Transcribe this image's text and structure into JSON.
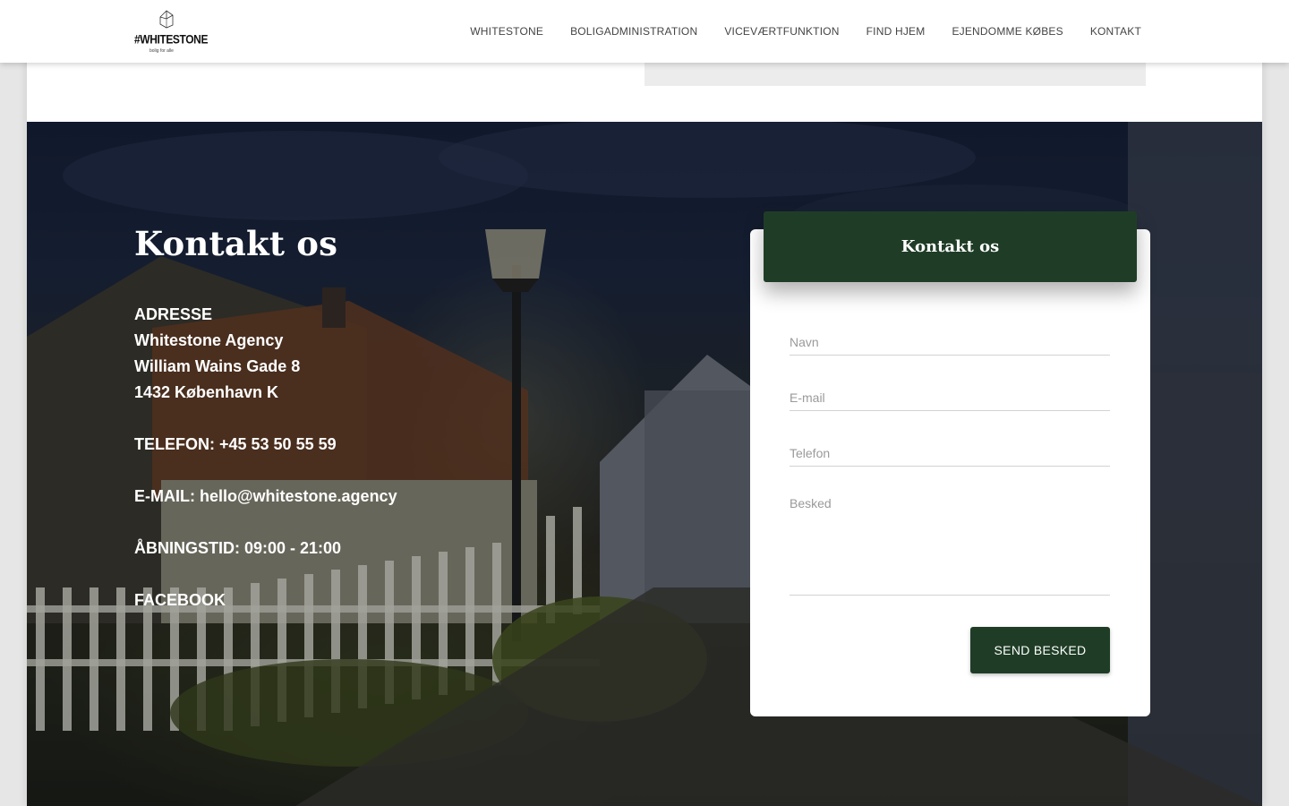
{
  "header": {
    "logo": {
      "name": "#WHITESTONE",
      "tagline": "bolig for alle"
    },
    "nav": [
      {
        "label": "WHITESTONE"
      },
      {
        "label": "BOLIGADMINISTRATION"
      },
      {
        "label": "VICEVÆRTFUNKTION"
      },
      {
        "label": "FIND HJEM"
      },
      {
        "label": "EJENDOMME KØBES"
      },
      {
        "label": "KONTAKT"
      }
    ]
  },
  "contact": {
    "title": "Kontakt os",
    "address_label": "ADRESSE",
    "address_lines": [
      "Whitestone Agency",
      "William Wains Gade 8",
      "1432 København K"
    ],
    "phone": "TELEFON: +45 53 50 55 59",
    "email": "E-MAIL: hello@whitestone.agency",
    "hours": "ÅBNINGSTID: 09:00 - 21:00",
    "facebook": "FACEBOOK"
  },
  "form": {
    "title": "Kontakt os",
    "name_placeholder": "Navn",
    "email_placeholder": "E-mail",
    "phone_placeholder": "Telefon",
    "message_placeholder": "Besked",
    "submit_label": "SEND BESKED"
  },
  "colors": {
    "brand_green": "#1f3d26",
    "white": "#ffffff",
    "nav_text": "#444444"
  }
}
